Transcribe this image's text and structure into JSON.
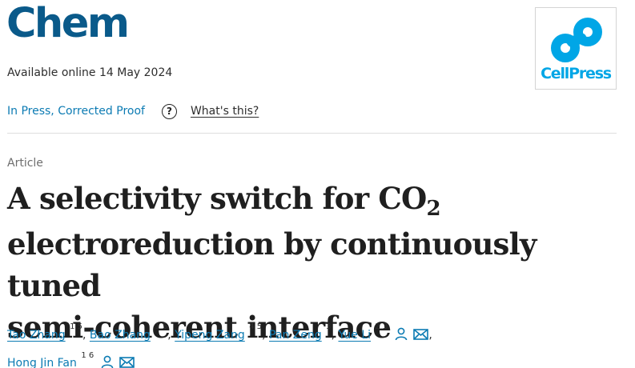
{
  "header": {
    "journal": "Chem",
    "available_online": "Available online 14 May 2024",
    "publisher_logo_text": "CellPress"
  },
  "status": {
    "label": "In Press, Corrected Proof",
    "help_icon": "question-circle-icon",
    "whats_this": "What's this?"
  },
  "article": {
    "type": "Article",
    "title_line1": "A selectivity switch for CO",
    "title_subscript": "2",
    "title_line2": "electroreduction by continuously tuned",
    "title_line3": "semi-coherent interface"
  },
  "authors": [
    {
      "name": "Tao Zhang",
      "aff": "1 5"
    },
    {
      "name": "Bao Zhang",
      "aff": "1 5"
    },
    {
      "name": "Yipeng Zang",
      "aff": "4 5"
    },
    {
      "name": "Pan Zeng",
      "aff": "3"
    },
    {
      "name": "Yue Li",
      "aff": "2 3",
      "icons": [
        "person-icon",
        "envelope-icon"
      ]
    },
    {
      "name": "Hong Jin Fan",
      "aff": "1 6",
      "icons": [
        "person-icon",
        "envelope-icon"
      ]
    }
  ],
  "colors": {
    "journal_blue": "#0a5a8a",
    "link_blue": "#0c7bb3",
    "cellpress_blue": "#00a6e6"
  }
}
